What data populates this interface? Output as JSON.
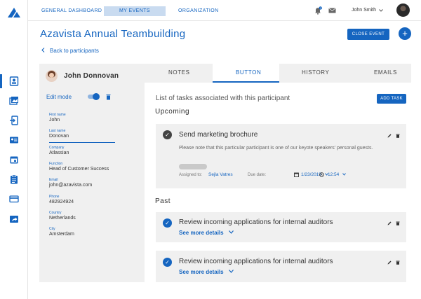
{
  "topnav": {
    "tabs": [
      {
        "label": "GENERAL DASHBOARD"
      },
      {
        "label": "MY EVENTS",
        "active": true
      },
      {
        "label": "ORGANIZATION"
      }
    ],
    "user_name": "John Smith",
    "notification_count": "2"
  },
  "header": {
    "title": "Azavista Annual Teambuilding",
    "close_event_label": "CLOSE EVENT",
    "add_label": "+",
    "back_label": "Back to participants"
  },
  "participant": {
    "name": "John Donnovan",
    "edit_mode_label": "Edit mode",
    "edit_mode_on": true,
    "fields": [
      {
        "label": "First name",
        "value": "John"
      },
      {
        "label": "Last name",
        "value": "Donovan"
      },
      {
        "label": "Company",
        "value": "Atlassian"
      },
      {
        "label": "Function",
        "value": "Head of Customer Success"
      },
      {
        "label": "Email",
        "value": "john@azavista.com"
      },
      {
        "label": "Phone",
        "value": "482924924"
      },
      {
        "label": "Country",
        "value": "Netherlands"
      },
      {
        "label": "City",
        "value": "Amsterdam"
      }
    ]
  },
  "tabs": [
    {
      "label": "NOTES"
    },
    {
      "label": "BUTTON",
      "active": true
    },
    {
      "label": "HISTORY"
    },
    {
      "label": "EMAILS"
    }
  ],
  "tasks": {
    "heading": "List of tasks associated with this participant",
    "add_task_label": "ADD TASK",
    "upcoming_label": "Upcoming",
    "past_label": "Past",
    "upcoming": [
      {
        "title": "Send marketing brochure",
        "description": "Please note that this particular participant is one of our keyote speakers' personal guests.",
        "assigned_label": "Assigned to:",
        "assignee": "Sejla Vatres",
        "due_label": "Due date:",
        "due_date": "1/23/2019",
        "due_time": "12:54"
      }
    ],
    "past": [
      {
        "title": "Review incoming applications for internal auditors",
        "see_more": "See more details"
      },
      {
        "title": "Review incoming applications for internal auditors",
        "see_more": "See more details"
      }
    ]
  },
  "colors": {
    "primary": "#1565c0",
    "panel_bg": "#f0f0f0",
    "nav_active_bg": "#c9dbf0"
  },
  "icons": {
    "rail": [
      "participant-card-icon",
      "gallery-icon",
      "import-icon",
      "badge-icon",
      "calendar-icon",
      "clipboard-icon",
      "credit-card-icon",
      "export-icon"
    ]
  }
}
